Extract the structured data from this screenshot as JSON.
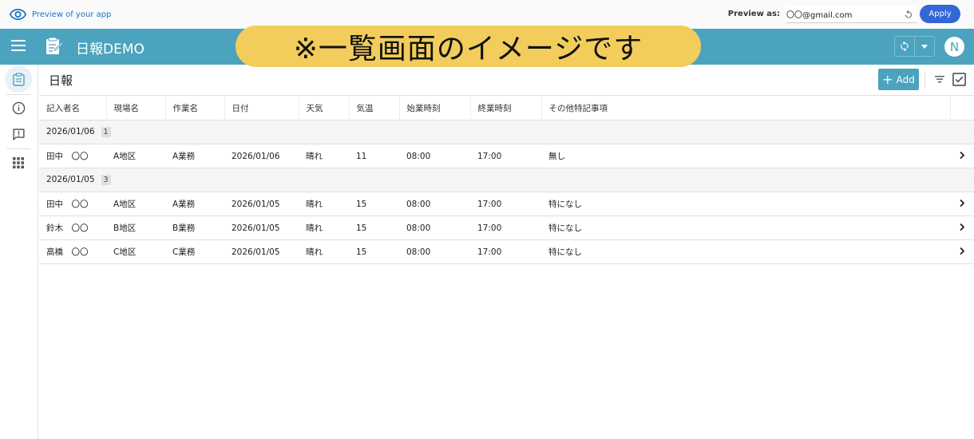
{
  "preview": {
    "label": "Preview of your app",
    "preview_as_label": "Preview as:",
    "email": "〇〇@gmail.com",
    "apply_label": "Apply"
  },
  "header": {
    "title": "日報DEMO",
    "banner": "※一覧画面のイメージです",
    "avatar_initial": "N"
  },
  "view": {
    "title": "日報",
    "add_label": "Add"
  },
  "table": {
    "columns": [
      "記入者名",
      "現場名",
      "作業名",
      "日付",
      "天気",
      "気温",
      "始業時刻",
      "終業時刻",
      "その他特記事項"
    ],
    "groups": [
      {
        "label": "2026/01/06",
        "count": "1",
        "rows": [
          [
            "田中　〇〇",
            "A地区",
            "A業務",
            "2026/01/06",
            "晴れ",
            "11",
            "08:00",
            "17:00",
            "無し"
          ]
        ]
      },
      {
        "label": "2026/01/05",
        "count": "3",
        "rows": [
          [
            "田中　〇〇",
            "A地区",
            "A業務",
            "2026/01/05",
            "晴れ",
            "15",
            "08:00",
            "17:00",
            "特になし"
          ],
          [
            "鈴木　〇〇",
            "B地区",
            "B業務",
            "2026/01/05",
            "晴れ",
            "15",
            "08:00",
            "17:00",
            "特になし"
          ],
          [
            "高橋　〇〇",
            "C地区",
            "C業務",
            "2026/01/05",
            "晴れ",
            "15",
            "08:00",
            "17:00",
            "特になし"
          ]
        ]
      }
    ]
  },
  "colors": {
    "header_bg": "#4ba3be",
    "banner_bg": "#f2cd5c",
    "apply_bg": "#3367d6"
  },
  "icons": {
    "preview": "eye-icon",
    "menu": "hamburger-menu-icon",
    "logo": "notepad-pencil-icon",
    "sync": "sync-icon",
    "rail": [
      "clipboard-icon",
      "info-icon",
      "feedback-icon",
      "apps-grid-icon"
    ],
    "filter": "filter-icon",
    "select": "checkbox-icon",
    "row": "chevron-right-icon"
  }
}
